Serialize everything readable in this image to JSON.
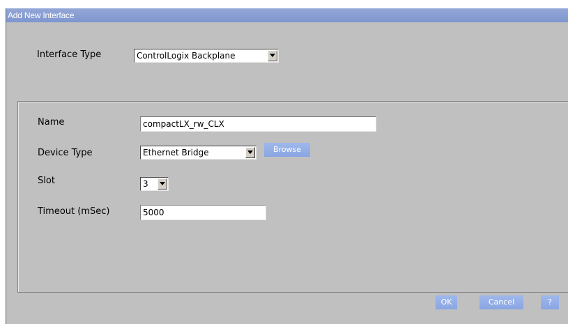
{
  "dialog": {
    "title": "Add New Interface"
  },
  "interface_type": {
    "label": "Interface Type",
    "value": "ControlLogix Backplane"
  },
  "form": {
    "name_label": "Name",
    "name_value": "compactLX_rw_CLX",
    "device_type_label": "Device Type",
    "device_type_value": "Ethernet Bridge",
    "browse_label": "Browse",
    "slot_label": "Slot",
    "slot_value": "3",
    "timeout_label": "Timeout (mSec)",
    "timeout_value": "5000"
  },
  "buttons": {
    "ok": "OK",
    "cancel": "Cancel",
    "help": "?"
  },
  "colors": {
    "titlebar": "#7e96cf",
    "dialog_bg": "#c0c0c0",
    "button": "#8aa5e2"
  },
  "icons": {
    "dropdown": "chevron-down-icon"
  }
}
